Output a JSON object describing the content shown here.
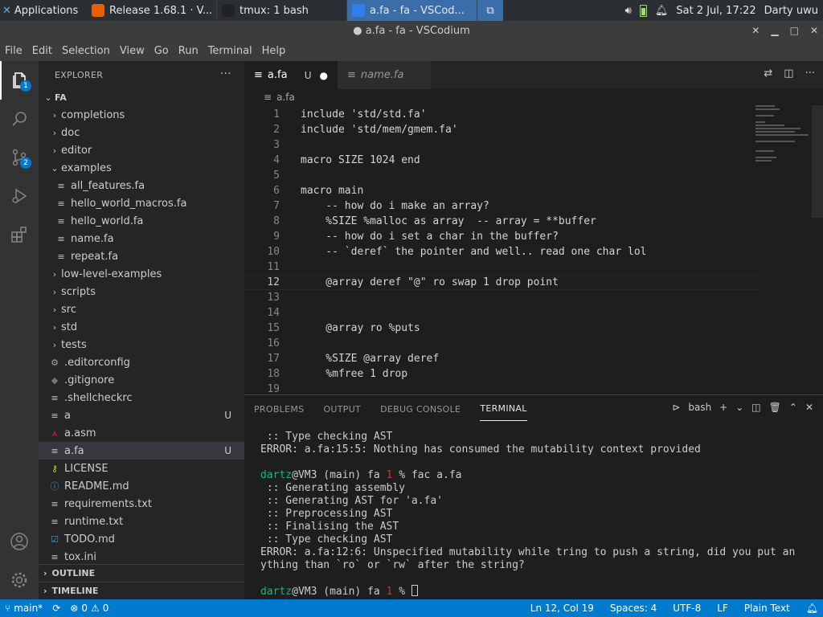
{
  "system_panel": {
    "applications_label": "Applications",
    "tasks": [
      {
        "label": "Release 1.68.1 · V...",
        "icon": "firefox-icon",
        "color": "#e66000"
      },
      {
        "label": "tmux: 1 bash",
        "icon": "terminal-icon",
        "color": "#222222"
      },
      {
        "label": "a.fa - fa - VSCod...",
        "icon": "vscodium-icon",
        "color": "#2f80ed"
      }
    ],
    "clock": "Sat  2 Jul, 17:22",
    "user": "Darty uwu"
  },
  "window": {
    "title": "● a.fa - fa - VSCodium",
    "controls": [
      "minimize",
      "maximize",
      "close"
    ]
  },
  "menu": [
    "File",
    "Edit",
    "Selection",
    "View",
    "Go",
    "Run",
    "Terminal",
    "Help"
  ],
  "activity_bar": {
    "explorer_badge": "1",
    "scm_badge": "2"
  },
  "explorer": {
    "header": "EXPLORER",
    "root": "FA",
    "items": [
      {
        "label": "completions",
        "type": "folder",
        "depth": 1,
        "open": false
      },
      {
        "label": "doc",
        "type": "folder",
        "depth": 1,
        "open": false
      },
      {
        "label": "editor",
        "type": "folder",
        "depth": 1,
        "open": false
      },
      {
        "label": "examples",
        "type": "folder",
        "depth": 1,
        "open": true
      },
      {
        "label": "all_features.fa",
        "type": "file",
        "depth": 2
      },
      {
        "label": "hello_world_macros.fa",
        "type": "file",
        "depth": 2
      },
      {
        "label": "hello_world.fa",
        "type": "file",
        "depth": 2
      },
      {
        "label": "name.fa",
        "type": "file",
        "depth": 2
      },
      {
        "label": "repeat.fa",
        "type": "file",
        "depth": 2
      },
      {
        "label": "low-level-examples",
        "type": "folder",
        "depth": 1,
        "open": false
      },
      {
        "label": "scripts",
        "type": "folder",
        "depth": 1,
        "open": false
      },
      {
        "label": "src",
        "type": "folder",
        "depth": 1,
        "open": false
      },
      {
        "label": "std",
        "type": "folder",
        "depth": 1,
        "open": false
      },
      {
        "label": "tests",
        "type": "folder",
        "depth": 1,
        "open": false
      },
      {
        "label": ".editorconfig",
        "type": "file",
        "depth": 1,
        "icon": "gear-icon"
      },
      {
        "label": ".gitignore",
        "type": "file",
        "depth": 1,
        "icon": "git-icon"
      },
      {
        "label": ".shellcheckrc",
        "type": "file",
        "depth": 1
      },
      {
        "label": "a",
        "type": "file",
        "depth": 1,
        "status": "U"
      },
      {
        "label": "a.asm",
        "type": "file",
        "depth": 1,
        "icon": "asm-icon"
      },
      {
        "label": "a.fa",
        "type": "file",
        "depth": 1,
        "status": "U",
        "selected": true
      },
      {
        "label": "LICENSE",
        "type": "file",
        "depth": 1,
        "icon": "license-icon"
      },
      {
        "label": "README.md",
        "type": "file",
        "depth": 1,
        "icon": "info-icon"
      },
      {
        "label": "requirements.txt",
        "type": "file",
        "depth": 1
      },
      {
        "label": "runtime.txt",
        "type": "file",
        "depth": 1
      },
      {
        "label": "TODO.md",
        "type": "file",
        "depth": 1,
        "icon": "check-icon"
      },
      {
        "label": "tox.ini",
        "type": "file",
        "depth": 1
      }
    ],
    "outline": "OUTLINE",
    "timeline": "TIMELINE"
  },
  "tabs": [
    {
      "label": "a.fa",
      "status": "U",
      "dirty": true,
      "active": true
    },
    {
      "label": "name.fa",
      "active": false
    }
  ],
  "breadcrumb": "a.fa",
  "editor": {
    "current_line": 12,
    "lines": [
      "include 'std/std.fa'",
      "include 'std/mem/gmem.fa'",
      "",
      "macro SIZE 1024 end",
      "",
      "macro main",
      "    -- how do i make an array?",
      "    %SIZE %malloc as array  -- array = **buffer",
      "    -- how do i set a char in the buffer?",
      "    -- `deref` the pointer and well.. read one char lol",
      "",
      "    @array deref \"@\" ro swap 1 drop point",
      "",
      "",
      "    @array ro %puts",
      "",
      "    %SIZE @array deref",
      "    %mfree 1 drop",
      ""
    ]
  },
  "panel": {
    "tabs": [
      "PROBLEMS",
      "OUTPUT",
      "DEBUG CONSOLE",
      "TERMINAL"
    ],
    "active_tab": "TERMINAL",
    "terminal_name": "bash",
    "terminal_lines": [
      {
        "kind": "plain",
        "text": " :: Type checking AST"
      },
      {
        "kind": "plain",
        "text": "ERROR: a.fa:15:5: Nothing has consumed the mutability context provided"
      },
      {
        "kind": "plain",
        "text": ""
      },
      {
        "kind": "prompt",
        "user": "dartz",
        "rest": "@VM3 (main) fa ",
        "code": "1",
        "cmd": " % fac a.fa"
      },
      {
        "kind": "plain",
        "text": " :: Generating assembly"
      },
      {
        "kind": "plain",
        "text": " :: Generating AST for 'a.fa'"
      },
      {
        "kind": "plain",
        "text": " :: Preprocessing AST"
      },
      {
        "kind": "plain",
        "text": " :: Finalising the AST"
      },
      {
        "kind": "plain",
        "text": " :: Type checking AST"
      },
      {
        "kind": "plain",
        "text": "ERROR: a.fa:12:6: Unspecified mutability while tring to push a string, did you put an"
      },
      {
        "kind": "plain",
        "text": "ything than `ro` or `rw` after the string?"
      },
      {
        "kind": "plain",
        "text": ""
      },
      {
        "kind": "prompt",
        "user": "dartz",
        "rest": "@VM3 (main) fa ",
        "code": "1",
        "cmd": " % ",
        "cursor": true
      }
    ]
  },
  "status_bar": {
    "branch": "main*",
    "errors": "0",
    "warnings": "0",
    "position": "Ln 12, Col 19",
    "spaces": "Spaces: 4",
    "encoding": "UTF-8",
    "eol": "LF",
    "language": "Plain Text"
  }
}
